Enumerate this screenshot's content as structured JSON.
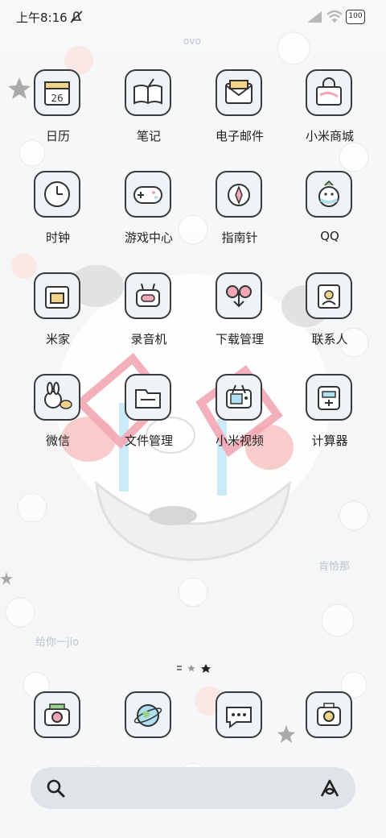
{
  "status_bar": {
    "time": "上午8:16",
    "battery": "100"
  },
  "wallpaper": {
    "text_ovo": "ovo",
    "text_right": "肯恰那",
    "text_left": "给你一jio"
  },
  "apps": [
    {
      "label": "日历",
      "icon": "calendar-icon"
    },
    {
      "label": "笔记",
      "icon": "notebook-icon"
    },
    {
      "label": "电子邮件",
      "icon": "envelope-icon"
    },
    {
      "label": "小米商城",
      "icon": "shopping-bag-icon"
    },
    {
      "label": "时钟",
      "icon": "clock-icon"
    },
    {
      "label": "游戏中心",
      "icon": "gamepad-icon"
    },
    {
      "label": "指南针",
      "icon": "compass-icon"
    },
    {
      "label": "QQ",
      "icon": "penguin-icon"
    },
    {
      "label": "米家",
      "icon": "home-device-icon"
    },
    {
      "label": "录音机",
      "icon": "recorder-icon"
    },
    {
      "label": "下载管理",
      "icon": "download-icon"
    },
    {
      "label": "联系人",
      "icon": "contacts-icon"
    },
    {
      "label": "微信",
      "icon": "chat-bunny-icon"
    },
    {
      "label": "文件管理",
      "icon": "folder-icon"
    },
    {
      "label": "小米视频",
      "icon": "tv-icon"
    },
    {
      "label": "计算器",
      "icon": "calculator-icon"
    }
  ],
  "dock": [
    {
      "icon": "camera-icon"
    },
    {
      "icon": "browser-globe-icon"
    },
    {
      "icon": "message-bubble-icon"
    },
    {
      "icon": "camera-app-icon"
    }
  ],
  "calendar_day": "26",
  "colors": {
    "outline": "#3a3a3a",
    "tile": "#eef3f8",
    "pink": "#f2a7b4",
    "blue": "#aee0f0"
  }
}
